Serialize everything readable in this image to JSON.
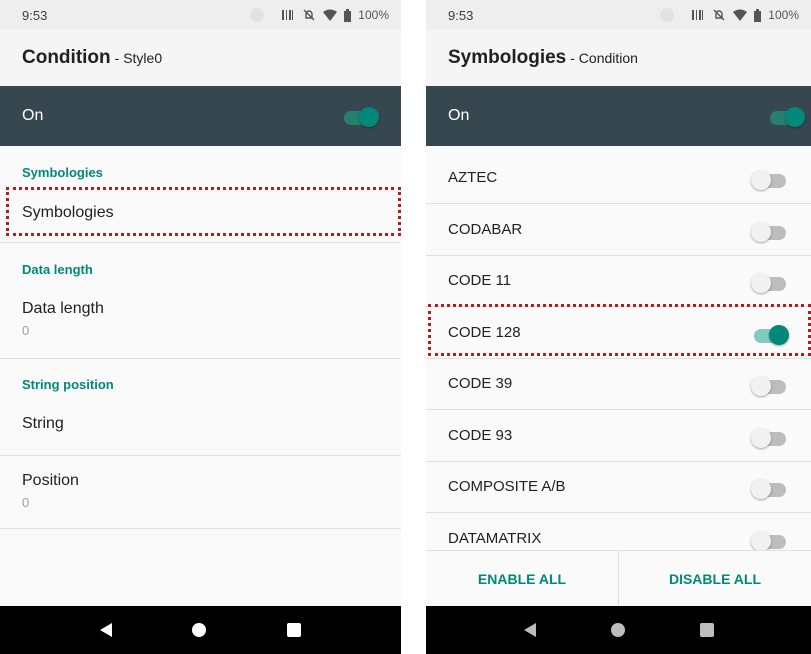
{
  "left_screen": {
    "status_bar": {
      "time": "9:53",
      "battery": "100%"
    },
    "app_bar": {
      "title": "Condition",
      "subtitle": "- Style0"
    },
    "master_switch": {
      "label": "On",
      "state": "on"
    },
    "sections": [
      {
        "header": "Symbologies",
        "item_title": "Symbologies"
      },
      {
        "header": "Data length",
        "item_title": "Data length",
        "item_value": "0"
      },
      {
        "header": "String position",
        "item_title": "String",
        "item2_title": "Position",
        "item2_value": "0"
      }
    ]
  },
  "right_screen": {
    "status_bar": {
      "time": "9:53",
      "battery": "100%"
    },
    "app_bar": {
      "title": "Symbologies",
      "subtitle": "- Condition"
    },
    "master_switch": {
      "label": "On",
      "state": "on"
    },
    "symbologies": [
      {
        "label": "AZTEC",
        "enabled": false
      },
      {
        "label": "CODABAR",
        "enabled": false
      },
      {
        "label": "CODE 11",
        "enabled": false
      },
      {
        "label": "CODE 128",
        "enabled": true
      },
      {
        "label": "CODE 39",
        "enabled": false
      },
      {
        "label": "CODE 93",
        "enabled": false
      },
      {
        "label": "COMPOSITE A/B",
        "enabled": false
      },
      {
        "label": "DATAMATRIX",
        "enabled": false
      }
    ],
    "buttons": {
      "enable_all": "ENABLE ALL",
      "disable_all": "DISABLE ALL"
    }
  },
  "colors": {
    "accent": "#00897b",
    "toolbar": "#37474f",
    "highlight": "#b71c1c"
  },
  "icons": [
    "scanner-icon",
    "mute-icon",
    "wifi-icon",
    "battery-icon",
    "back-icon",
    "home-icon",
    "recents-icon"
  ]
}
